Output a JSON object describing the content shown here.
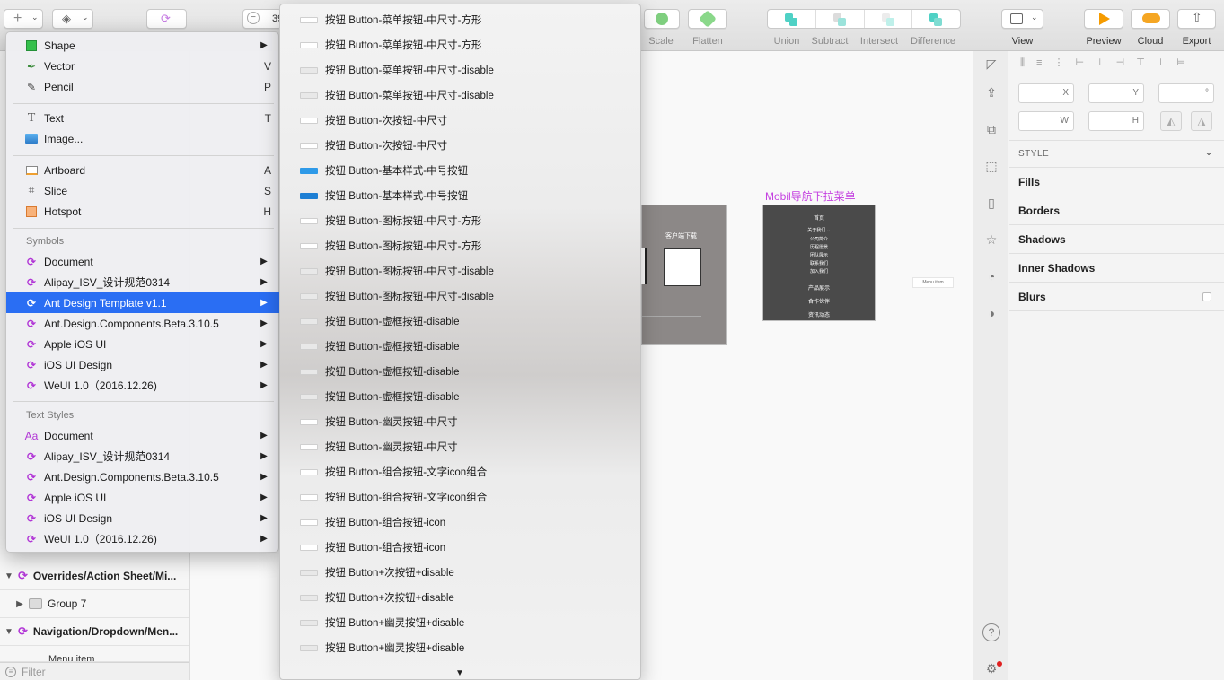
{
  "toolbar": {
    "zoom_value": "39",
    "labels": {
      "scale": "Scale",
      "flatten": "Flatten",
      "union": "Union",
      "subtract": "Subtract",
      "intersect": "Intersect",
      "difference": "Difference",
      "view": "View",
      "preview": "Preview",
      "cloud": "Cloud",
      "export": "Export"
    }
  },
  "left_panel": {
    "rows": [
      {
        "label": "Overrides/Action Sheet/Mi..."
      },
      {
        "label": "Group 7"
      },
      {
        "label": "Navigation/Dropdown/Men..."
      },
      {
        "label": "Menu item"
      }
    ],
    "filter_placeholder": "Filter"
  },
  "insert_menu": {
    "items": [
      {
        "label": "Shape",
        "icon": "shape-icon",
        "shortcut": "",
        "arrow": "▶"
      },
      {
        "label": "Vector",
        "icon": "vector-pen-icon",
        "shortcut": "V"
      },
      {
        "label": "Pencil",
        "icon": "pencil-icon",
        "shortcut": "P"
      },
      {
        "label": "Text",
        "icon": "text-icon",
        "shortcut": "T"
      },
      {
        "label": "Image...",
        "icon": "image-icon",
        "shortcut": ""
      },
      {
        "label": "Artboard",
        "icon": "artboard-icon",
        "shortcut": "A"
      },
      {
        "label": "Slice",
        "icon": "slice-icon",
        "shortcut": "S"
      },
      {
        "label": "Hotspot",
        "icon": "hotspot-icon",
        "shortcut": "H"
      }
    ],
    "symbols_header": "Symbols",
    "symbols": [
      {
        "label": "Document"
      },
      {
        "label": "Alipay_ISV_设计规范0314"
      },
      {
        "label": "Ant Design Template v1.1",
        "selected": true
      },
      {
        "label": "Ant.Design.Components.Beta.3.10.5"
      },
      {
        "label": "Apple iOS UI"
      },
      {
        "label": "iOS UI Design"
      },
      {
        "label": "WeUI 1.0（2016.12.26)"
      }
    ],
    "text_styles_header": "Text Styles",
    "text_styles": [
      {
        "label": "Document",
        "icon": "Aa"
      },
      {
        "label": "Alipay_ISV_设计规范0314"
      },
      {
        "label": "Ant.Design.Components.Beta.3.10.5"
      },
      {
        "label": "Apple iOS UI"
      },
      {
        "label": "iOS UI Design"
      },
      {
        "label": "WeUI 1.0（2016.12.26)"
      }
    ],
    "arrow_glyph": "▶"
  },
  "sub_menu": {
    "items": [
      {
        "label": "按钮 Button-菜单按钮-中尺寸-方形",
        "thumb": "white"
      },
      {
        "label": "按钮 Button-菜单按钮-中尺寸-方形",
        "thumb": "white"
      },
      {
        "label": "按钮 Button-菜单按钮-中尺寸-disable",
        "thumb": "gray"
      },
      {
        "label": "按钮 Button-菜单按钮-中尺寸-disable",
        "thumb": "gray"
      },
      {
        "label": "按钮 Button-次按钮-中尺寸",
        "thumb": "white"
      },
      {
        "label": "按钮 Button-次按钮-中尺寸",
        "thumb": "white"
      },
      {
        "label": "按钮 Button-基本样式-中号按钮",
        "thumb": "blue"
      },
      {
        "label": "按钮 Button-基本样式-中号按钮",
        "thumb": "blue2"
      },
      {
        "label": "按钮 Button-图标按钮-中尺寸-方形",
        "thumb": "white"
      },
      {
        "label": "按钮 Button-图标按钮-中尺寸-方形",
        "thumb": "white"
      },
      {
        "label": "按钮 Button-图标按钮-中尺寸-disable",
        "thumb": "gray"
      },
      {
        "label": "按钮 Button-图标按钮-中尺寸-disable",
        "thumb": "gray"
      },
      {
        "label": "按钮 Button-虚框按钮-disable",
        "thumb": "gray"
      },
      {
        "label": "按钮 Button-虚框按钮-disable",
        "thumb": "gray"
      },
      {
        "label": "按钮 Button-虚框按钮-disable",
        "thumb": "gray"
      },
      {
        "label": "按钮 Button-虚框按钮-disable",
        "thumb": "gray"
      },
      {
        "label": "按钮 Button-幽灵按钮-中尺寸",
        "thumb": "white"
      },
      {
        "label": "按钮 Button-幽灵按钮-中尺寸",
        "thumb": "white"
      },
      {
        "label": "按钮 Button-组合按钮-文字icon组合",
        "thumb": "white"
      },
      {
        "label": "按钮 Button-组合按钮-文字icon组合",
        "thumb": "white"
      },
      {
        "label": "按钮 Button-组合按钮-icon",
        "thumb": "white"
      },
      {
        "label": "按钮 Button-组合按钮-icon",
        "thumb": "white"
      },
      {
        "label": "按钮 Button+次按钮+disable",
        "thumb": "gray"
      },
      {
        "label": "按钮 Button+次按钮+disable",
        "thumb": "gray"
      },
      {
        "label": "按钮 Button+幽灵按钮+disable",
        "thumb": "gray"
      },
      {
        "label": "按钮 Button+幽灵按钮+disable",
        "thumb": "gray"
      }
    ],
    "scroll_arrow": "▼"
  },
  "canvas": {
    "artboard_title": "Mobil导航下拉菜单",
    "gray_artboard_text": "客户端下载",
    "dark_artboard_items": [
      "首页",
      "关于我们 ⌄",
      "公司简介",
      "历程愿景",
      "团队展示",
      "联系我们",
      "加入我们",
      "产品展示",
      "合作伙伴",
      "资讯动态"
    ],
    "menu_item_label": "Menu item"
  },
  "inspector": {
    "fields": {
      "x": "X",
      "y": "Y",
      "rotation": "°",
      "w": "W",
      "h": "H"
    },
    "style_header": "STYLE",
    "sections": [
      "Fills",
      "Borders",
      "Shadows",
      "Inner Shadows",
      "Blurs"
    ]
  },
  "colors": {
    "accent": "#2a6ef3",
    "symbol_purple": "#b135d6",
    "artboard_title": "#c440e0",
    "preview_orange": "#f59b00",
    "cloud_orange": "#f5a623"
  }
}
